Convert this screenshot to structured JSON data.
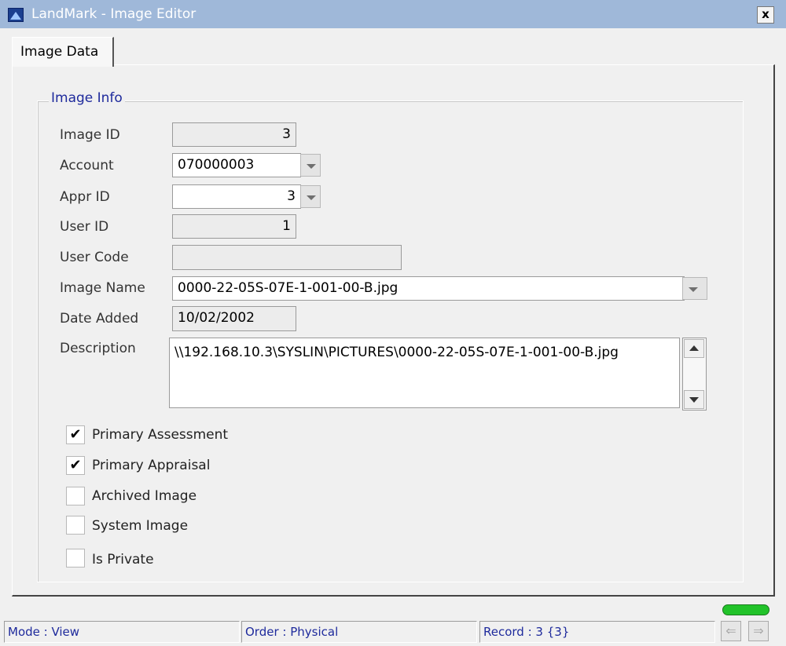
{
  "window": {
    "title": "LandMark - Image Editor",
    "close_glyph": "x"
  },
  "tabs": [
    {
      "label": "Image Data"
    }
  ],
  "group": {
    "title": "Image Info"
  },
  "fields": {
    "image_id": {
      "label": "Image ID",
      "value": "3"
    },
    "account": {
      "label": "Account",
      "value": "070000003"
    },
    "appr_id": {
      "label": "Appr ID",
      "value": "3"
    },
    "user_id": {
      "label": "User ID",
      "value": "1"
    },
    "user_code": {
      "label": "User Code",
      "value": ""
    },
    "image_name": {
      "label": "Image Name",
      "value": "0000-22-05S-07E-1-001-00-B.jpg"
    },
    "date_added": {
      "label": "Date Added",
      "value": "10/02/2002"
    },
    "description": {
      "label": "Description",
      "value": "\\\\192.168.10.3\\SYSLIN\\PICTURES\\0000-22-05S-07E-1-001-00-B.jpg"
    }
  },
  "checkboxes": [
    {
      "label": "Primary Assessment",
      "checked": true,
      "mark": "✔"
    },
    {
      "label": "Primary Appraisal",
      "checked": true,
      "mark": "✔"
    },
    {
      "label": "Archived Image",
      "checked": false,
      "mark": ""
    },
    {
      "label": "System Image",
      "checked": false,
      "mark": ""
    },
    {
      "label": "Is Private",
      "checked": false,
      "mark": ""
    }
  ],
  "status": {
    "mode": "Mode : View",
    "order": "Order : Physical",
    "record": "Record : 3 {3}",
    "prev_glyph": "⇐",
    "next_glyph": "⇒"
  }
}
